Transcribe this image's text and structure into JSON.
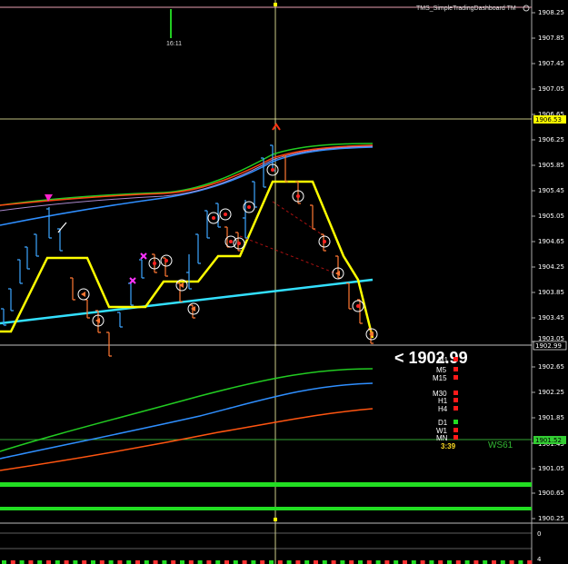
{
  "header": {
    "indicator_name": "TMS_SimpleTradingDashboard TM"
  },
  "price_axis": {
    "labels": [
      "1908.25",
      "1907.85",
      "1907.45",
      "1907.05",
      "1906.65",
      "1906.25",
      "1905.85",
      "1905.45",
      "1905.05",
      "1904.65",
      "1904.25",
      "1903.85",
      "1903.45",
      "1903.05",
      "1902.65",
      "1902.25",
      "1901.85",
      "1901.45",
      "1901.05",
      "1900.65",
      "1900.25"
    ]
  },
  "markers": {
    "crosshair_price": "1906.53",
    "current_price": "1902.99",
    "level_price": "1901.52",
    "time_label": "16:11"
  },
  "dashboard": {
    "price_readout": "<  1902.99",
    "timeframes": [
      {
        "label": "M1",
        "status": "sell",
        "color": "#ff1a1a"
      },
      {
        "label": "M5",
        "status": "sell",
        "color": "#ff1a1a"
      },
      {
        "label": "M15",
        "status": "sell",
        "color": "#ff1a1a"
      },
      {
        "label": "M30",
        "status": "sell",
        "color": "#ff1a1a"
      },
      {
        "label": "H1",
        "status": "sell",
        "color": "#ff1a1a"
      },
      {
        "label": "H4",
        "status": "sell",
        "color": "#ff1a1a"
      },
      {
        "label": "D1",
        "status": "buy",
        "color": "#22dd22"
      },
      {
        "label": "W1",
        "status": "sell",
        "color": "#ff1a1a"
      },
      {
        "label": "MN",
        "status": "sell",
        "color": "#ff1a1a"
      }
    ],
    "countdown": "3:39",
    "code": "WS61"
  },
  "sub_window": {
    "axis_top": "0",
    "axis_bottom": "4"
  },
  "colors": {
    "background": "#000000",
    "yellow": "#ffff00",
    "cyan": "#33e0ff",
    "green_ma": "#22cc22",
    "blue_ma": "#2f8fff",
    "orange_ma": "#ff5511",
    "bar_blue": "#3da5ff",
    "bar_orange": "#ff7733"
  }
}
